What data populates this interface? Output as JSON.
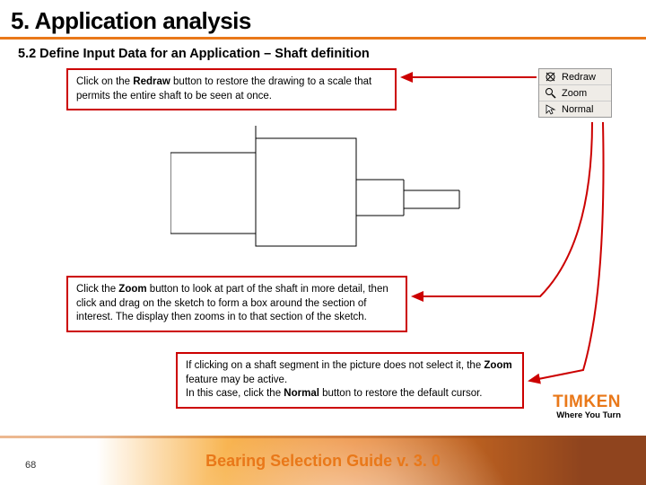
{
  "header": {
    "title": "5. Application analysis"
  },
  "subhead": "5.2 Define Input Data for an Application – Shaft definition",
  "callouts": {
    "a_pre": "Click on the ",
    "a_bold": "Redraw",
    "a_post": " button to restore the drawing to a scale that permits the entire shaft to be seen at once.",
    "b_pre": "Click the ",
    "b_bold": "Zoom",
    "b_post": " button to look at part of the shaft in more detail, then click and drag on the sketch to form a box around the section of interest. The display then zooms in to that section of the sketch.",
    "c_pre": "If clicking on a shaft segment in the picture does not select it, the ",
    "c_bold1": "Zoom",
    "c_mid": " feature may be active.\nIn this case, click the ",
    "c_bold2": "Normal",
    "c_post": " button to restore the default cursor."
  },
  "toolbar": {
    "items": [
      {
        "icon": "redraw-icon",
        "label": "Redraw"
      },
      {
        "icon": "zoom-icon",
        "label": "Zoom"
      },
      {
        "icon": "normal-icon",
        "label": "Normal"
      }
    ]
  },
  "logo": {
    "brand": "TIMKEN",
    "tagline": "Where You Turn"
  },
  "footer": {
    "page": "68",
    "title": "Bearing Selection Guide v. 3. 0"
  }
}
